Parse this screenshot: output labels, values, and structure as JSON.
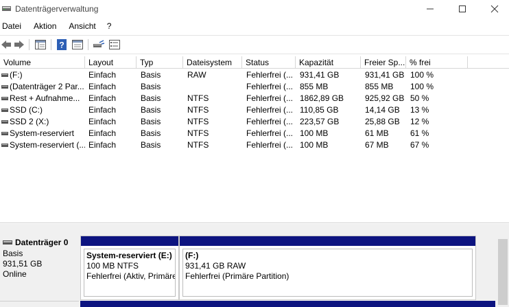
{
  "window": {
    "title": "Datenträgerverwaltung",
    "minimize": "—",
    "maximize": "☐",
    "close": "✕"
  },
  "menu": [
    "Datei",
    "Aktion",
    "Ansicht",
    "?"
  ],
  "toolbar": {
    "buttons": [
      "back-icon",
      "forward-icon",
      "console-tree-icon",
      "help-icon",
      "properties-icon",
      "rescan-icon",
      "list-view-icon"
    ]
  },
  "table": {
    "columns": [
      "Volume",
      "Layout",
      "Typ",
      "Dateisystem",
      "Status",
      "Kapazität",
      "Freier Sp...",
      "% frei"
    ],
    "rows": [
      [
        "(F:)",
        "Einfach",
        "Basis",
        "RAW",
        "Fehlerfrei (...",
        "931,41 GB",
        "931,41 GB",
        "100 %"
      ],
      [
        "(Datenträger 2 Par...",
        "Einfach",
        "Basis",
        "",
        "Fehlerfrei (...",
        "855 MB",
        "855 MB",
        "100 %"
      ],
      [
        "Rest + Aufnahme...",
        "Einfach",
        "Basis",
        "NTFS",
        "Fehlerfrei (...",
        "1862,89 GB",
        "925,92 GB",
        "50 %"
      ],
      [
        "SSD (C:)",
        "Einfach",
        "Basis",
        "NTFS",
        "Fehlerfrei (...",
        "110,85 GB",
        "14,14 GB",
        "13 %"
      ],
      [
        "SSD 2 (X:)",
        "Einfach",
        "Basis",
        "NTFS",
        "Fehlerfrei (...",
        "223,57 GB",
        "25,88 GB",
        "12 %"
      ],
      [
        "System-reserviert",
        "Einfach",
        "Basis",
        "NTFS",
        "Fehlerfrei (...",
        "100 MB",
        "61 MB",
        "61 %"
      ],
      [
        "System-reserviert (...",
        "Einfach",
        "Basis",
        "NTFS",
        "Fehlerfrei (...",
        "100 MB",
        "67 MB",
        "67 %"
      ]
    ]
  },
  "disk0": {
    "name": "Datenträger 0",
    "type": "Basis",
    "size": "931,51 GB",
    "state": "Online",
    "partitions": [
      {
        "title": "System-reserviert  (E:)",
        "line1": "100 MB NTFS",
        "line2": "Fehlerfrei (Aktiv, Primäre"
      },
      {
        "title": "(F:)",
        "line1": "931,41 GB RAW",
        "line2": "Fehlerfrei (Primäre Partition)"
      }
    ]
  },
  "colors": {
    "partition_bar": "#0d1480"
  }
}
